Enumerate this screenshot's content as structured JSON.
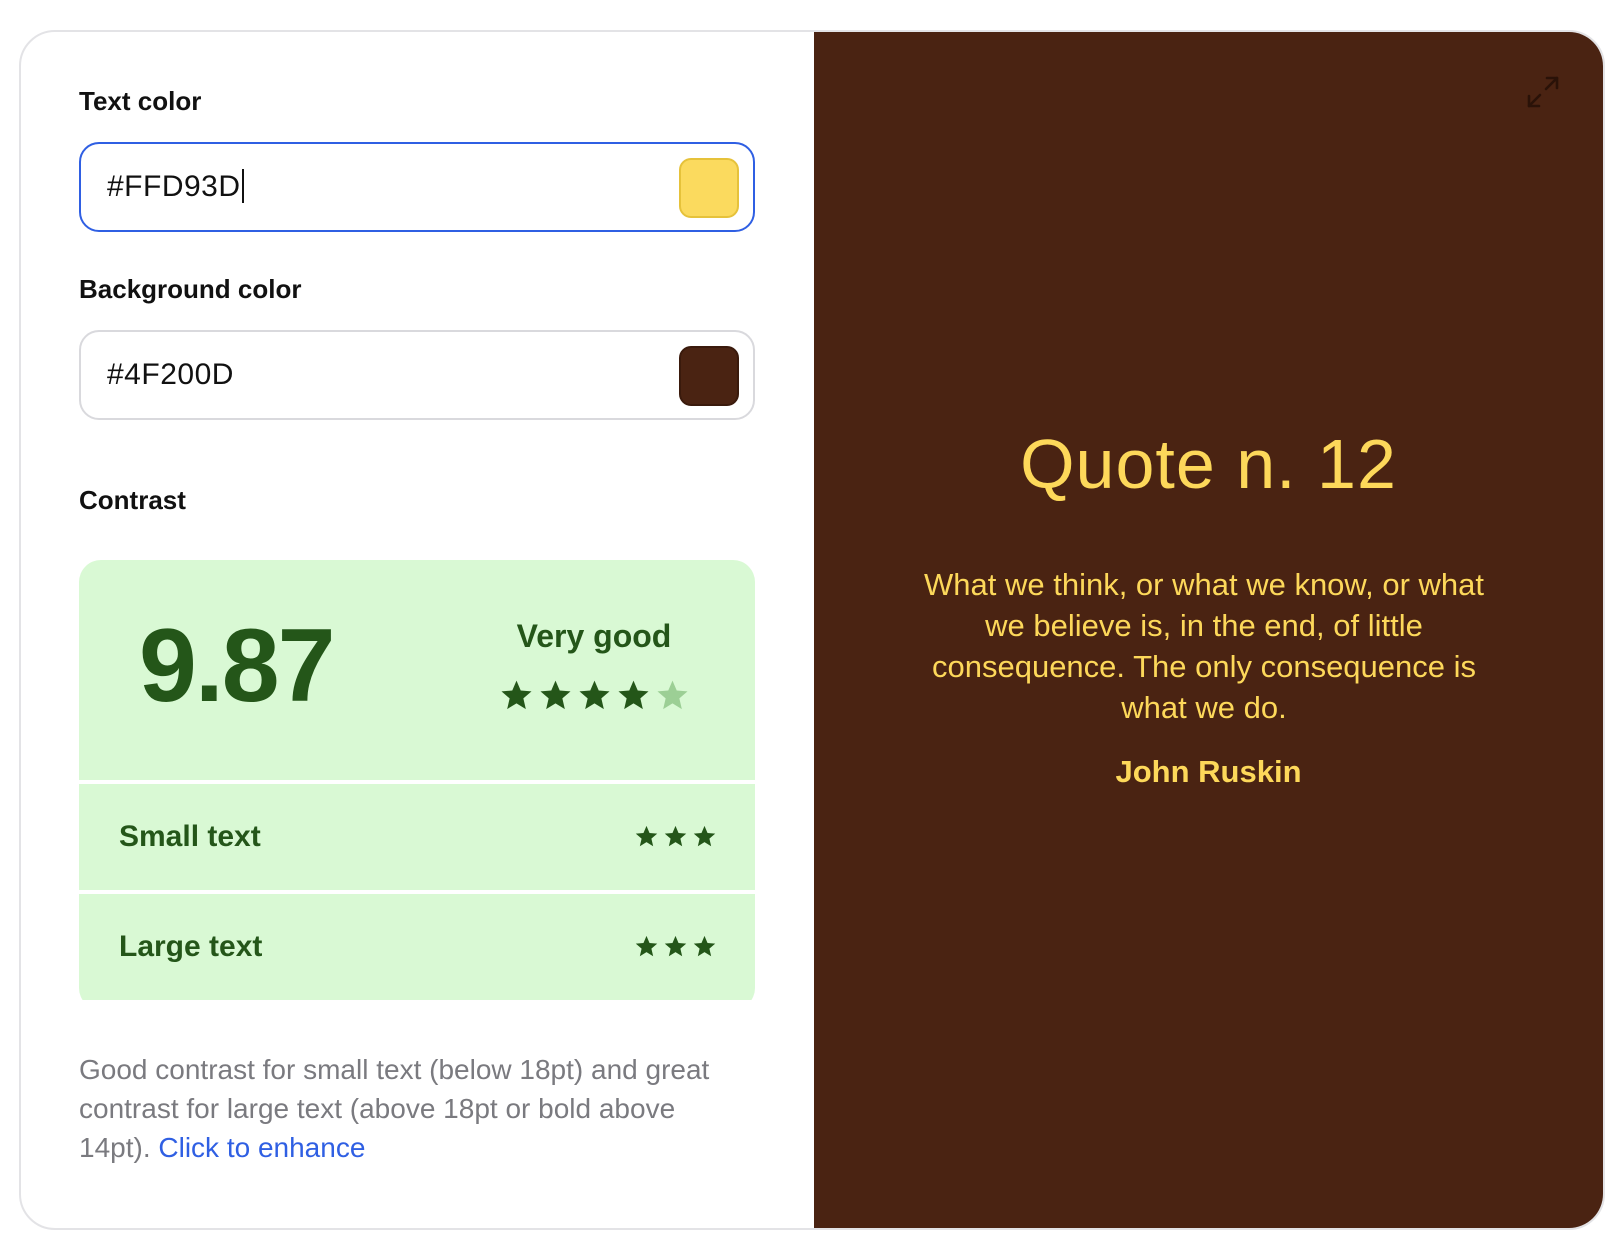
{
  "text_color": {
    "label": "Text color",
    "value": "#FFD93D",
    "swatch": "#FBDA5E",
    "swatch_border": "#E6C23A"
  },
  "background_color": {
    "label": "Background color",
    "value": "#4F200D",
    "swatch": "#4A2312",
    "swatch_border": "#3a1a0c"
  },
  "contrast": {
    "label": "Contrast",
    "score": "9.87",
    "rating": "Very good",
    "stars_filled": 4,
    "stars_total": 5,
    "rows": [
      {
        "label": "Small text",
        "stars": 3
      },
      {
        "label": "Large text",
        "stars": 3
      }
    ],
    "accent": "#245619",
    "accent_light": "#9ccf95",
    "panel_bg": "#D9F9D4"
  },
  "description": {
    "text": "Good contrast for small text (below 18pt) and great contrast for large text (above 18pt or bold above 14pt).",
    "link": "Click to enhance"
  },
  "preview": {
    "title": "Quote n. 12",
    "quote": "What we think, or what we know, or what we believe is, in the end, of little consequence. The only consequence is what we do.",
    "author": "John Ruskin",
    "expand_icon": "expand-icon"
  }
}
